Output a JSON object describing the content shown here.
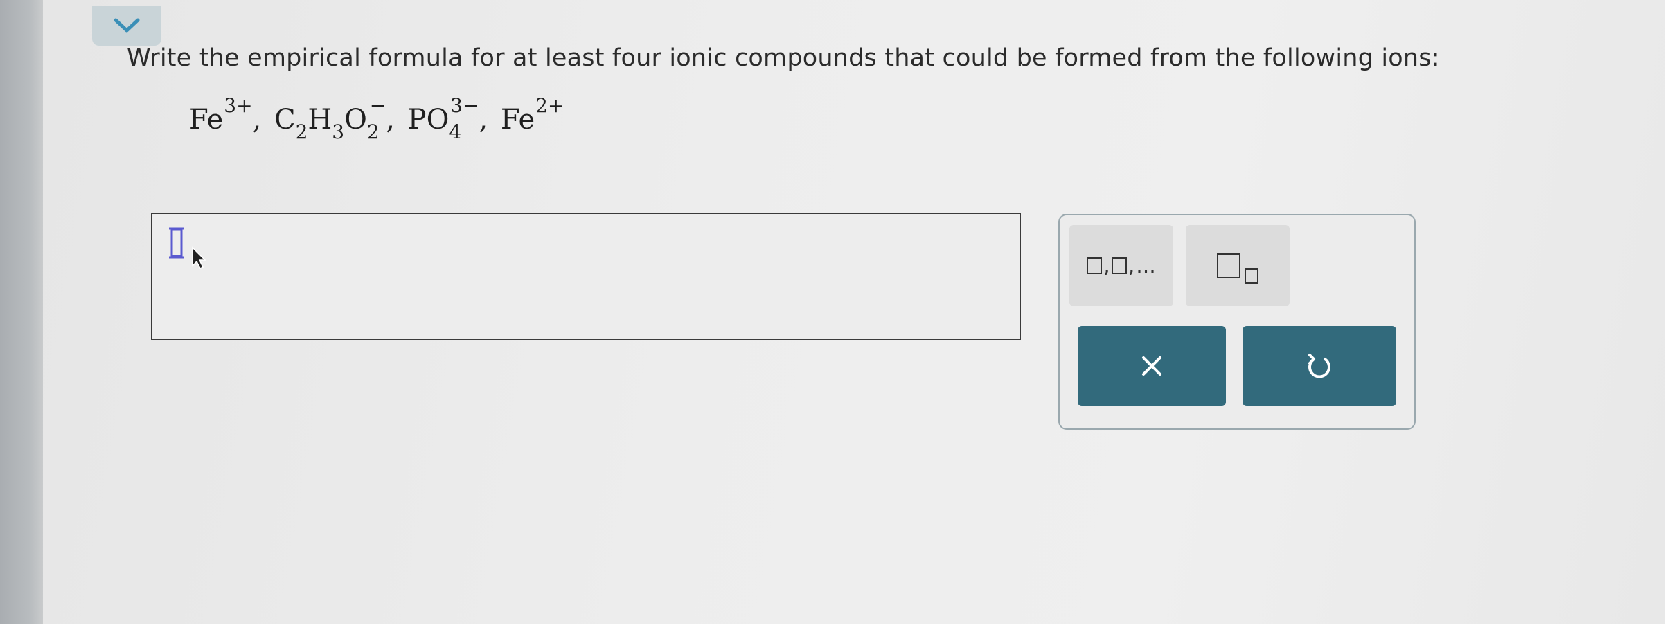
{
  "question": {
    "prompt": "Write the empirical formula for at least four ionic compounds that could be formed from the following ions:"
  },
  "ions": [
    {
      "base": "Fe",
      "charge": "3+"
    },
    {
      "base": "C",
      "sub1": "2",
      "mid1": "H",
      "sub2": "3",
      "mid2": "O",
      "sub3": "2",
      "charge": "−"
    },
    {
      "base": "PO",
      "sub1": "4",
      "charge": "3−"
    },
    {
      "base": "Fe",
      "charge": "2+"
    }
  ],
  "separators": [
    ",",
    ",",
    ","
  ],
  "toolbar": {
    "list_template_label": ",",
    "list_ellipsis": "...",
    "clear_icon": "close-icon",
    "undo_icon": "undo-icon"
  },
  "colors": {
    "action_button": "#326a7c",
    "collapse_button": "#c9d4d8",
    "chevron": "#3a8fb7",
    "cursor": "#5a5ad0"
  }
}
